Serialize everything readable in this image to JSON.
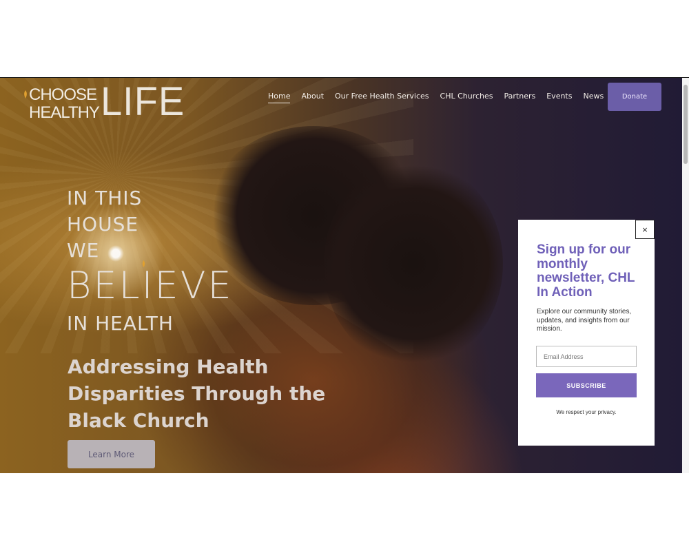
{
  "logo": {
    "line1": "CHOOSE",
    "line2": "HEALTHY",
    "word": "LIFE"
  },
  "nav": {
    "items": [
      {
        "label": "Home",
        "active": true
      },
      {
        "label": "About"
      },
      {
        "label": "Our Free Health Services"
      },
      {
        "label": "CHL Churches"
      },
      {
        "label": "Partners"
      },
      {
        "label": "Events"
      },
      {
        "label": "News"
      }
    ],
    "donate_label": "Donate"
  },
  "hero": {
    "tagline_lines": [
      "IN THIS",
      "HOUSE",
      "WE",
      "BELIEVE",
      "IN HEALTH"
    ],
    "subheadline": "Addressing Health Disparities Through the Black Church",
    "cta_label": "Learn More"
  },
  "popup": {
    "close_glyph": "×",
    "title": "Sign up for our monthly newsletter, CHL In Action",
    "description": "Explore our community stories, updates, and insights from our mission.",
    "email_placeholder": "Email Address",
    "subscribe_label": "SUBSCRIBE",
    "privacy_note": "We respect your privacy."
  },
  "colors": {
    "accent": "#6b5ea8",
    "popup_title": "#6f60b8",
    "subscribe": "#7a67bb",
    "flame": "#e0a030"
  }
}
